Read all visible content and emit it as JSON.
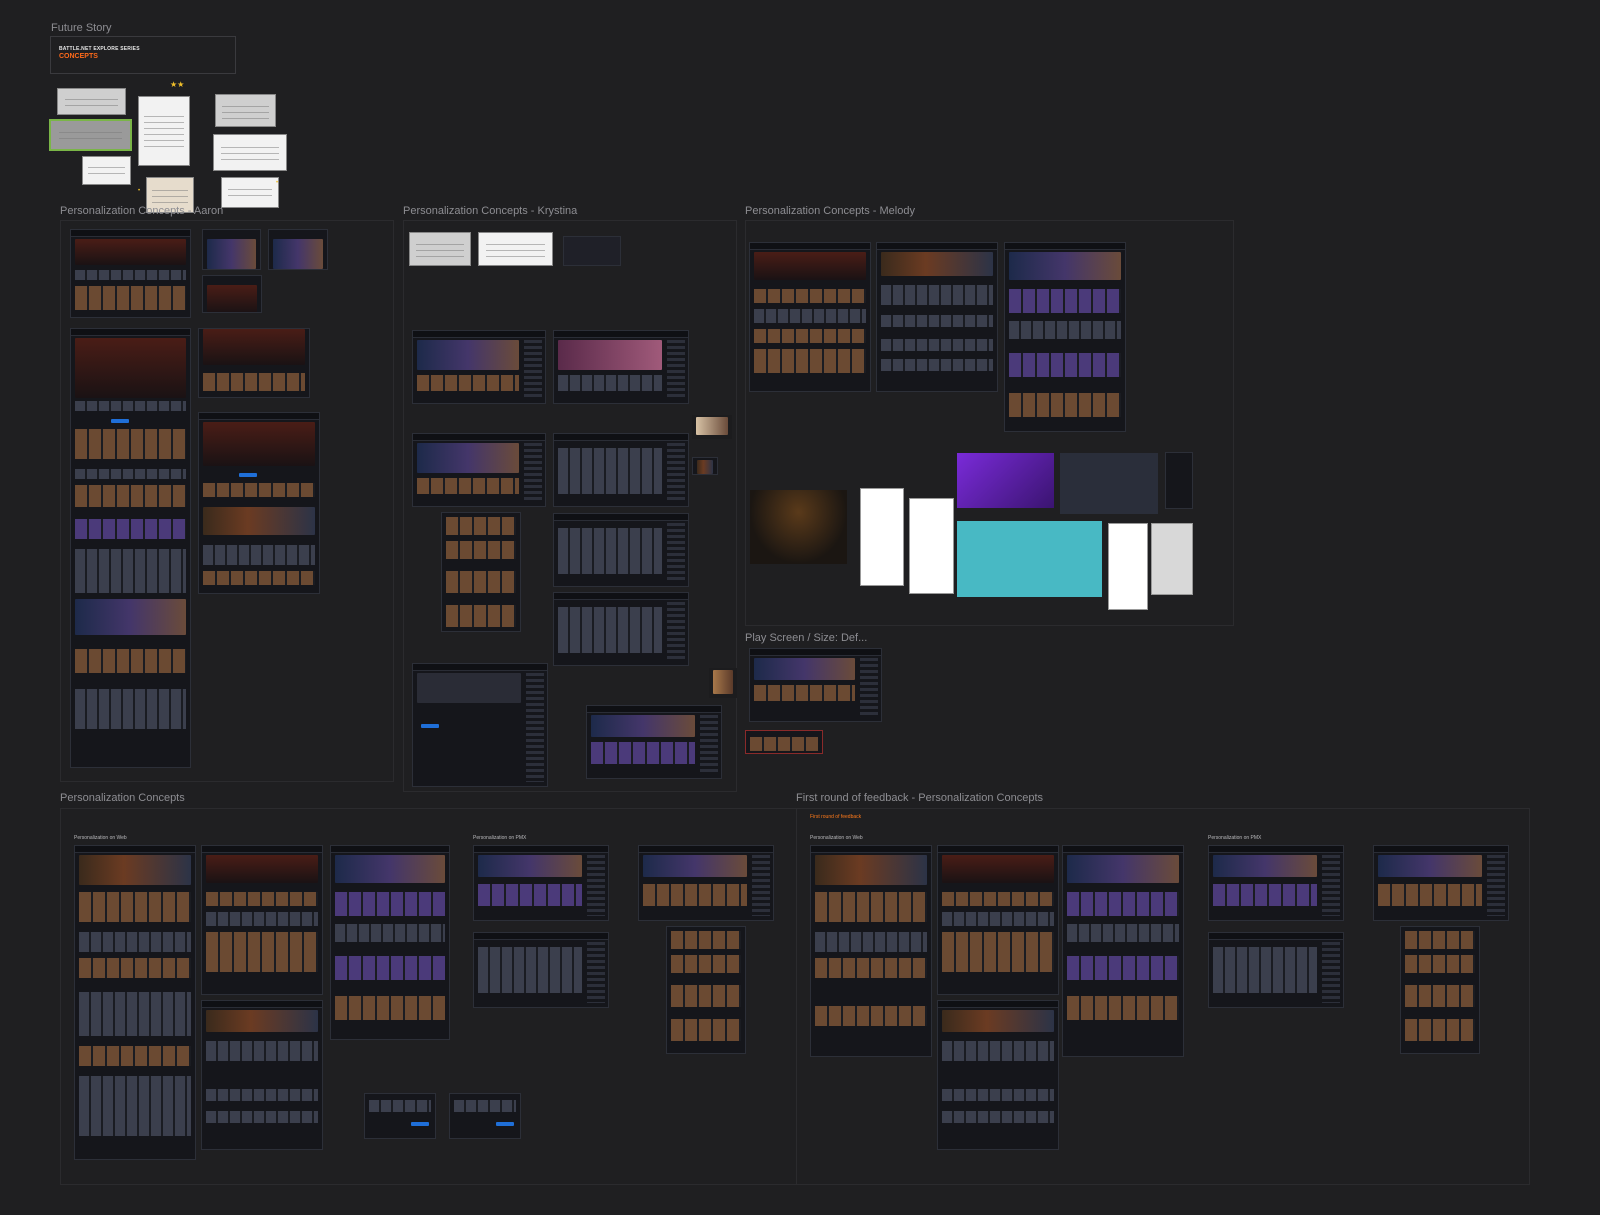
{
  "sections": {
    "future_story": "Future Story",
    "aaron": "Personalization Concepts - Aaron",
    "krystina": "Personalization Concepts - Krystina",
    "melody": "Personalization Concepts - Melody",
    "play_screen": "Play Screen / Size: Def...",
    "concepts": "Personalization Concepts",
    "feedback": "First round of feedback - Personalization Concepts"
  },
  "concepts_card": {
    "subtitle": "BATTLE.NET EXPLORE SERIES",
    "title": "CONCEPTS"
  },
  "captions": {
    "web_left": "Personalization on Web",
    "pmx_left": "Personalization on PMX",
    "web_right": "Personalization on Web",
    "pmx_right": "Personalization on PMX",
    "feedback_tag": "First round of feedback"
  },
  "colors": {
    "canvas": "#1f1f21",
    "accent_orange": "#ff6a1a",
    "accent_blue": "#1f6fd8"
  }
}
